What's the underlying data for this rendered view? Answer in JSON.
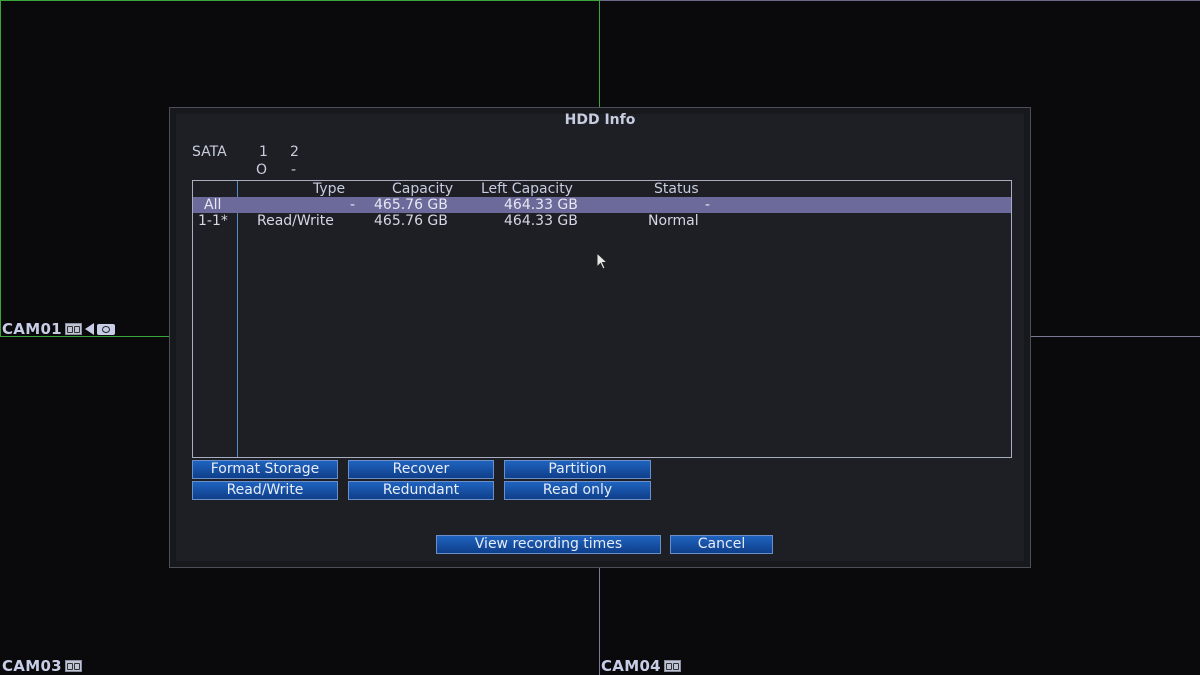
{
  "cameras": {
    "cam01": "CAM01",
    "cam03": "CAM03",
    "cam04": "CAM04"
  },
  "dialog": {
    "title": "HDD Info",
    "sata_label": "SATA",
    "sata_ports": [
      "1",
      "2"
    ],
    "sata_values": [
      "O",
      "-"
    ]
  },
  "table": {
    "headers": {
      "type": "Type",
      "capacity": "Capacity",
      "left_capacity": "Left Capacity",
      "status": "Status"
    },
    "rows": [
      {
        "id": "All",
        "type": "-",
        "capacity": "465.76 GB",
        "left_capacity": "464.33 GB",
        "status": "-"
      },
      {
        "id": "1-1*",
        "type": "Read/Write",
        "capacity": "465.76 GB",
        "left_capacity": "464.33 GB",
        "status": "Normal"
      }
    ]
  },
  "buttons": {
    "format_storage": "Format Storage",
    "recover": "Recover",
    "partition": "Partition",
    "read_write": "Read/Write",
    "redundant": "Redundant",
    "read_only": "Read only",
    "view_recording_times": "View recording times",
    "cancel": "Cancel"
  },
  "colors": {
    "button_blue": "#1a56b0",
    "selected_row": "#6c6a9a",
    "grid_green": "#3aa63a"
  }
}
